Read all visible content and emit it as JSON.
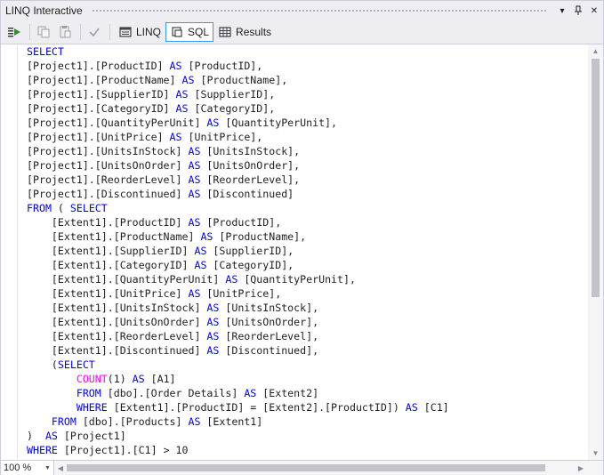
{
  "window": {
    "title": "LINQ Interactive",
    "dropdown_glyph": "▾",
    "pin_glyph": "⊣",
    "close_glyph": "✕"
  },
  "toolbar": {
    "linq_label": "LINQ",
    "sql_label": "SQL",
    "results_label": "Results"
  },
  "editor": {
    "lines": [
      [
        {
          "t": "SELECT",
          "k": "kw"
        }
      ],
      [
        {
          "t": "[Project1].[ProductID] "
        },
        {
          "t": "AS",
          "k": "kw"
        },
        {
          "t": " [ProductID],"
        }
      ],
      [
        {
          "t": "[Project1].[ProductName] "
        },
        {
          "t": "AS",
          "k": "kw"
        },
        {
          "t": " [ProductName],"
        }
      ],
      [
        {
          "t": "[Project1].[SupplierID] "
        },
        {
          "t": "AS",
          "k": "kw"
        },
        {
          "t": " [SupplierID],"
        }
      ],
      [
        {
          "t": "[Project1].[CategoryID] "
        },
        {
          "t": "AS",
          "k": "kw"
        },
        {
          "t": " [CategoryID],"
        }
      ],
      [
        {
          "t": "[Project1].[QuantityPerUnit] "
        },
        {
          "t": "AS",
          "k": "kw"
        },
        {
          "t": " [QuantityPerUnit],"
        }
      ],
      [
        {
          "t": "[Project1].[UnitPrice] "
        },
        {
          "t": "AS",
          "k": "kw"
        },
        {
          "t": " [UnitPrice],"
        }
      ],
      [
        {
          "t": "[Project1].[UnitsInStock] "
        },
        {
          "t": "AS",
          "k": "kw"
        },
        {
          "t": " [UnitsInStock],"
        }
      ],
      [
        {
          "t": "[Project1].[UnitsOnOrder] "
        },
        {
          "t": "AS",
          "k": "kw"
        },
        {
          "t": " [UnitsOnOrder],"
        }
      ],
      [
        {
          "t": "[Project1].[ReorderLevel] "
        },
        {
          "t": "AS",
          "k": "kw"
        },
        {
          "t": " [ReorderLevel],"
        }
      ],
      [
        {
          "t": "[Project1].[Discontinued] "
        },
        {
          "t": "AS",
          "k": "kw"
        },
        {
          "t": " [Discontinued]"
        }
      ],
      [
        {
          "t": "FROM",
          "k": "kw"
        },
        {
          "t": " ( "
        },
        {
          "t": "SELECT",
          "k": "kw"
        }
      ],
      [
        {
          "t": "    [Extent1].[ProductID] "
        },
        {
          "t": "AS",
          "k": "kw"
        },
        {
          "t": " [ProductID],"
        }
      ],
      [
        {
          "t": "    [Extent1].[ProductName] "
        },
        {
          "t": "AS",
          "k": "kw"
        },
        {
          "t": " [ProductName],"
        }
      ],
      [
        {
          "t": "    [Extent1].[SupplierID] "
        },
        {
          "t": "AS",
          "k": "kw"
        },
        {
          "t": " [SupplierID],"
        }
      ],
      [
        {
          "t": "    [Extent1].[CategoryID] "
        },
        {
          "t": "AS",
          "k": "kw"
        },
        {
          "t": " [CategoryID],"
        }
      ],
      [
        {
          "t": "    [Extent1].[QuantityPerUnit] "
        },
        {
          "t": "AS",
          "k": "kw"
        },
        {
          "t": " [QuantityPerUnit],"
        }
      ],
      [
        {
          "t": "    [Extent1].[UnitPrice] "
        },
        {
          "t": "AS",
          "k": "kw"
        },
        {
          "t": " [UnitPrice],"
        }
      ],
      [
        {
          "t": "    [Extent1].[UnitsInStock] "
        },
        {
          "t": "AS",
          "k": "kw"
        },
        {
          "t": " [UnitsInStock],"
        }
      ],
      [
        {
          "t": "    [Extent1].[UnitsOnOrder] "
        },
        {
          "t": "AS",
          "k": "kw"
        },
        {
          "t": " [UnitsOnOrder],"
        }
      ],
      [
        {
          "t": "    [Extent1].[ReorderLevel] "
        },
        {
          "t": "AS",
          "k": "kw"
        },
        {
          "t": " [ReorderLevel],"
        }
      ],
      [
        {
          "t": "    [Extent1].[Discontinued] "
        },
        {
          "t": "AS",
          "k": "kw"
        },
        {
          "t": " [Discontinued],"
        }
      ],
      [
        {
          "t": "    ("
        },
        {
          "t": "SELECT",
          "k": "kw"
        }
      ],
      [
        {
          "t": "        "
        },
        {
          "t": "COUNT",
          "k": "fn"
        },
        {
          "t": "(1) "
        },
        {
          "t": "AS",
          "k": "kw"
        },
        {
          "t": " [A1]"
        }
      ],
      [
        {
          "t": "        "
        },
        {
          "t": "FROM",
          "k": "kw"
        },
        {
          "t": " [dbo].[Order Details] "
        },
        {
          "t": "AS",
          "k": "kw"
        },
        {
          "t": " [Extent2]"
        }
      ],
      [
        {
          "t": "        "
        },
        {
          "t": "WHERE",
          "k": "kw"
        },
        {
          "t": " [Extent1].[ProductID] = [Extent2].[ProductID]) "
        },
        {
          "t": "AS",
          "k": "kw"
        },
        {
          "t": " [C1]"
        }
      ],
      [
        {
          "t": "    "
        },
        {
          "t": "FROM",
          "k": "kw"
        },
        {
          "t": " [dbo].[Products] "
        },
        {
          "t": "AS",
          "k": "kw"
        },
        {
          "t": " [Extent1]"
        }
      ],
      [
        {
          "t": ")  "
        },
        {
          "t": "AS",
          "k": "kw"
        },
        {
          "t": " [Project1]"
        }
      ],
      [
        {
          "t": "WHERE",
          "k": "kw"
        },
        {
          "t": " [Project1].[C1] > 10"
        }
      ]
    ]
  },
  "status": {
    "zoom": "100 %"
  },
  "colors": {
    "keyword": "#0000ff",
    "function": "#ff00ff",
    "active_border": "#3399ff"
  }
}
